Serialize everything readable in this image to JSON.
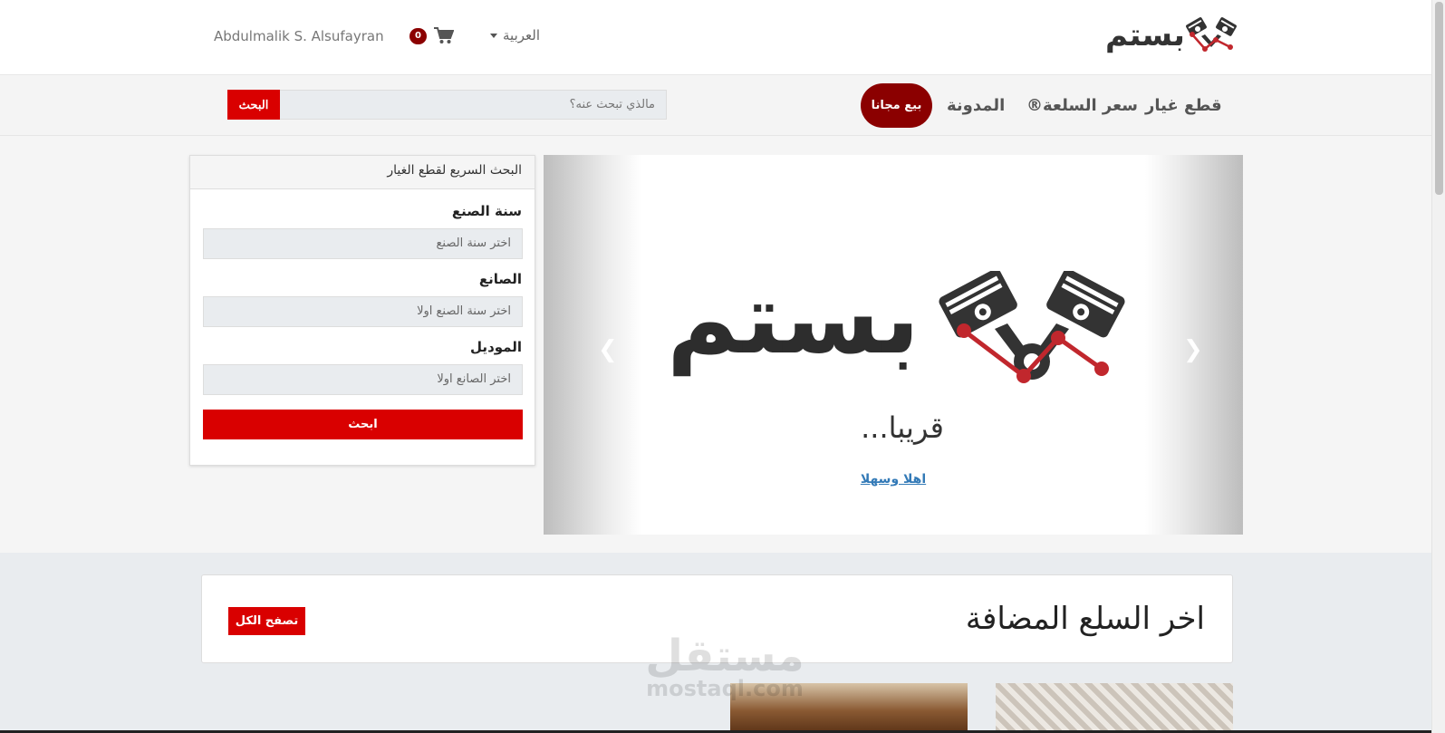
{
  "header": {
    "logo_text": "بستم",
    "language": "العربية",
    "cart_count": "0",
    "user_name": "Abdulmalik S. Alsufayran"
  },
  "nav": {
    "items": [
      "قطع غيار",
      "سعر السلعة®",
      "المدونة"
    ],
    "sell_button": "بيع مجانا",
    "search_placeholder": "مالذي تبحث عنه؟",
    "search_button": "البحث"
  },
  "quick_search": {
    "title": "البحث السريع لقطع الغيار",
    "fields": [
      {
        "label": "سنة الصنع",
        "placeholder": "اختر سنة الصنع"
      },
      {
        "label": "الصانع",
        "placeholder": "اختر سنة الصنع اولا"
      },
      {
        "label": "الموديل",
        "placeholder": "اختر الصانع اولا"
      }
    ],
    "submit": "ابحث"
  },
  "carousel": {
    "logo_text": "بستم",
    "caption": "قريبا...",
    "link": "اهلا وسهلا"
  },
  "latest": {
    "title": "اخر السلع المضافة",
    "browse_button": "تصفح الكل"
  },
  "watermark": {
    "arabic": "مستقل",
    "latin": "mostaql.com"
  },
  "colors": {
    "primary_red": "#d90000",
    "dark_red": "#8b0000"
  }
}
